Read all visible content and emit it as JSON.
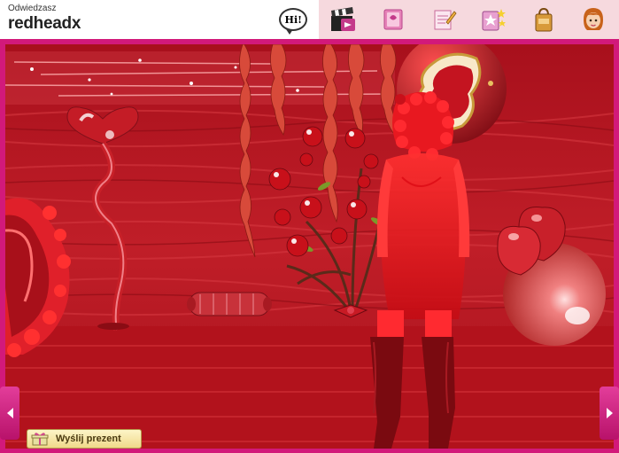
{
  "header": {
    "visit_label": "Odwiedzasz",
    "username": "redheadx"
  },
  "toolbar": {
    "items": [
      {
        "name": "hi",
        "label": "Hi!",
        "active": true
      },
      {
        "name": "movies",
        "icon": "clapperboard-icon"
      },
      {
        "name": "diary",
        "icon": "diary-icon"
      },
      {
        "name": "notes",
        "icon": "notepad-pencil-icon"
      },
      {
        "name": "stars",
        "icon": "star-book-icon"
      },
      {
        "name": "shop",
        "icon": "shopping-bag-icon"
      },
      {
        "name": "avatar",
        "icon": "girl-avatar-icon"
      }
    ]
  },
  "room": {
    "theme_color": "#b3141f"
  },
  "actions": {
    "send_gift_label": "Wyślij prezent"
  },
  "colors": {
    "frame": "#d2197a",
    "toolbar_bg": "#f6d9de",
    "room": "#b3141f"
  }
}
